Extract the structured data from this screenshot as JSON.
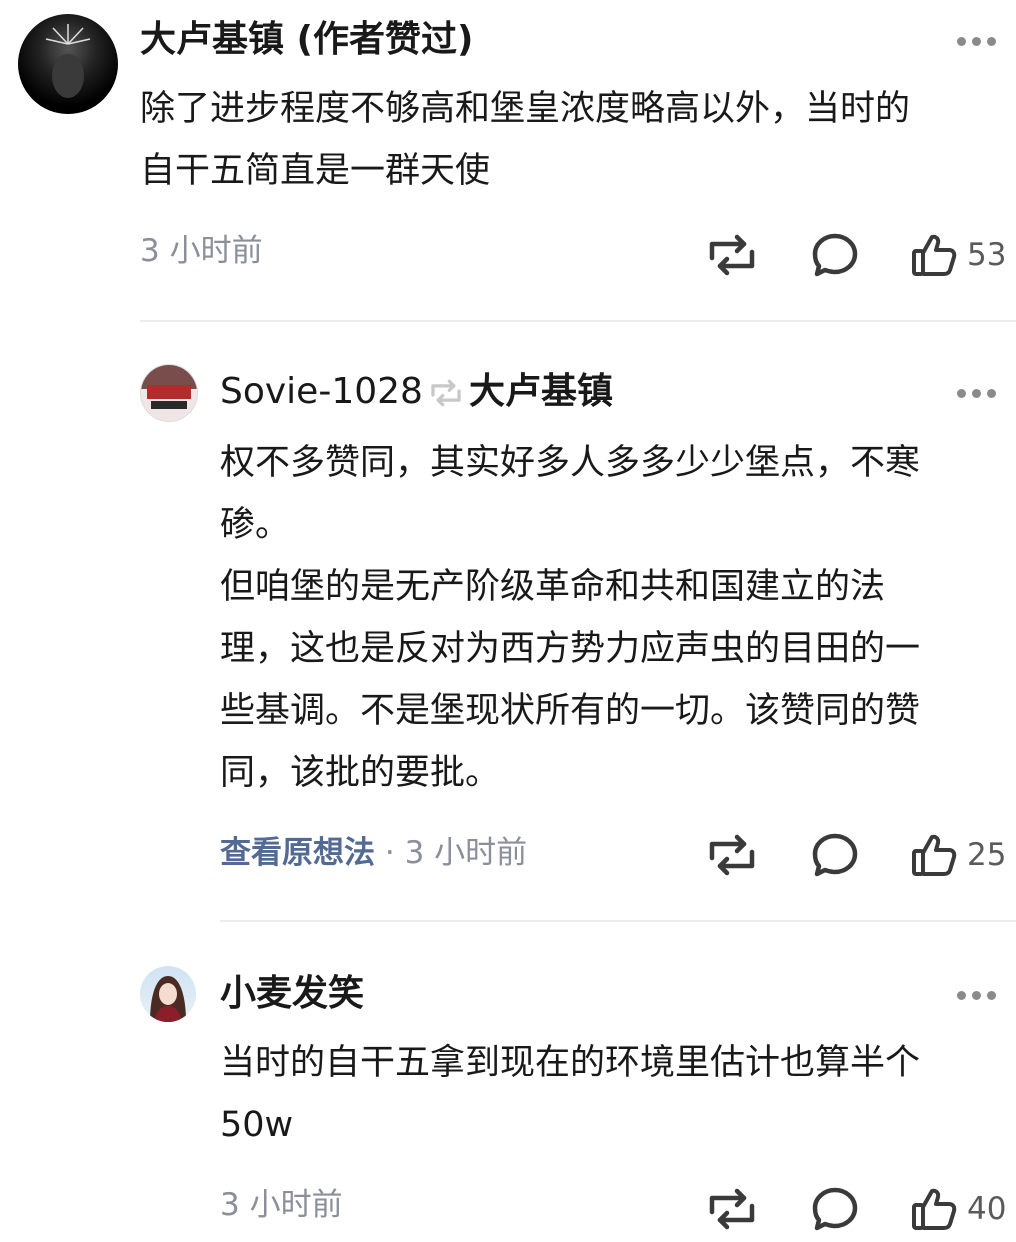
{
  "comments": [
    {
      "author": "大卢基镇 (作者赞过)",
      "body": "除了进步程度不够高和堡皇浓度略高以外，当时的\n自干五简直是一群天使",
      "meta_link": "",
      "time": "3 小时前",
      "likes": "53",
      "icons": {
        "repost": "repost-icon",
        "comment": "comment-icon",
        "like": "like-icon",
        "more": "more-icon"
      }
    },
    {
      "author": "Sovie-1028",
      "reply_to": "大卢基镇",
      "body": "权不多赞同，其实好多人多多少少堡点，不寒\n碜。\n但咱堡的是无产阶级革命和共和国建立的法\n理，这也是反对为西方势力应声虫的目田的一\n些基调。不是堡现状所有的一切。该赞同的赞\n同，该批的要批。",
      "meta_link": "查看原想法",
      "meta_sep": " · ",
      "time": "3 小时前",
      "likes": "25"
    },
    {
      "author": "小麦发笑",
      "body": "当时的自干五拿到现在的环境里估计也算半个\n50w",
      "meta_link": "",
      "time": "3 小时前",
      "likes": "40"
    }
  ]
}
